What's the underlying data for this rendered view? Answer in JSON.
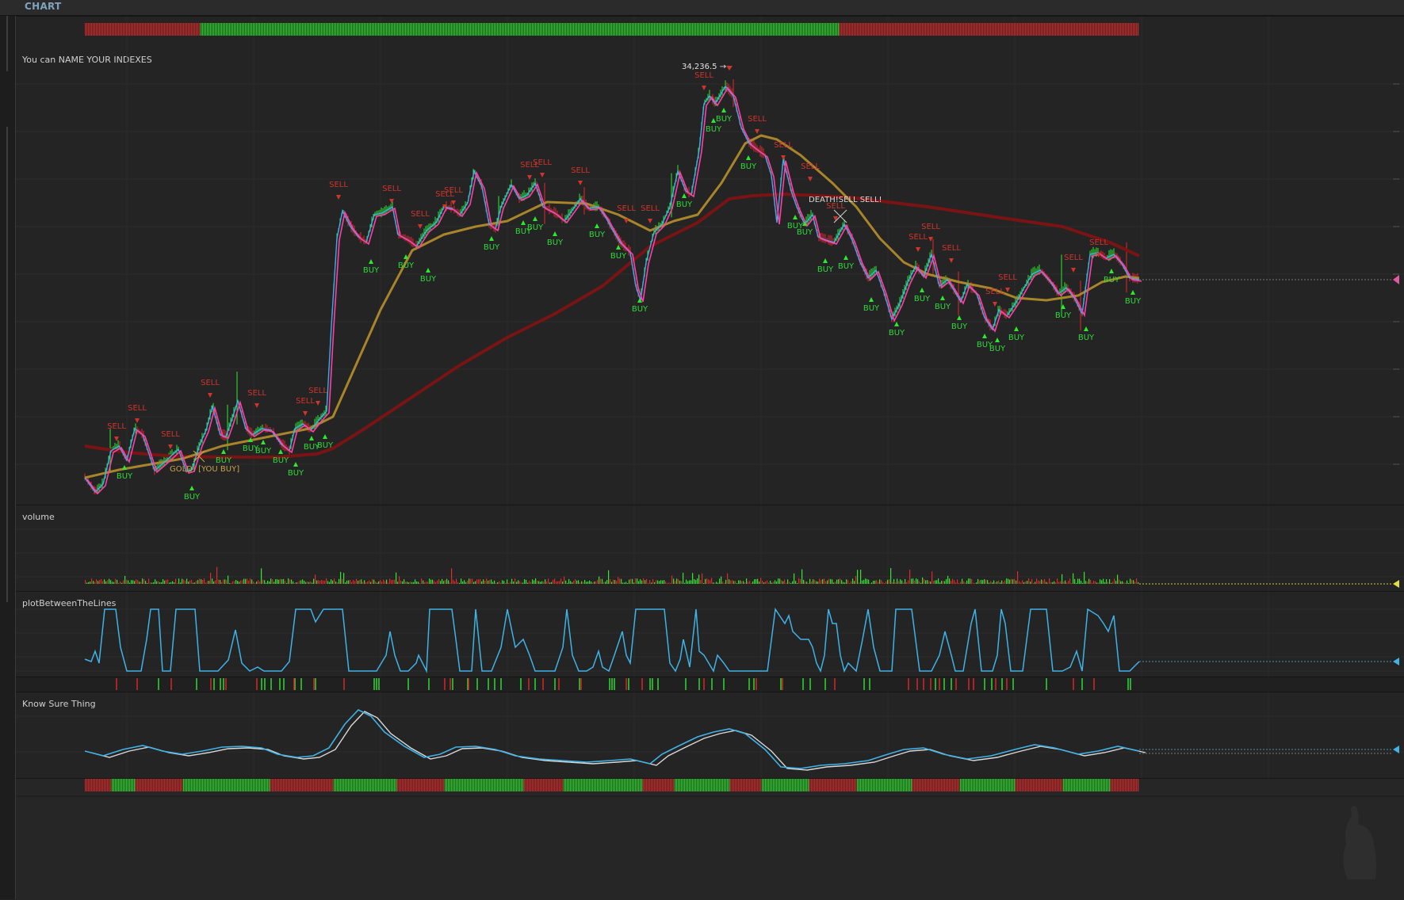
{
  "header": {
    "title": "CHART"
  },
  "panes": {
    "price": {
      "label": "You can NAME YOUR INDEXES",
      "peak_label": "34,236.5 →",
      "gold_cross": "GOLD! [YOU BUY]",
      "death_cross": "DEATH!SELL SELL!",
      "buy": "BUY",
      "sell": "SELL"
    },
    "volume": {
      "label": "volume"
    },
    "between": {
      "label": "plotBetweenTheLines"
    },
    "kst": {
      "label": "Know Sure Thing"
    }
  },
  "colors": {
    "bull": "#2ee82e",
    "bear": "#e02a2a",
    "sell_text": "#d0342c",
    "buy_text": "#2fd93a",
    "fast_ma": "#ff3fa8",
    "fast_ma2": "#3fb8ff",
    "ma50": "#a8852a",
    "ma200": "#7a1414",
    "osc": "#3fb2e6",
    "kst_signal": "#d8d8d8"
  },
  "chart_data": [
    {
      "type": "line",
      "title": "You can NAME YOUR INDEXES",
      "series": [],
      "annotations": [
        "34,236.5",
        "GOLD! [YOU BUY]",
        "DEATH!SELL SELL!",
        "BUY",
        "SELL"
      ]
    },
    {
      "type": "bar",
      "title": "volume",
      "series": []
    },
    {
      "type": "line",
      "title": "plotBetweenTheLines",
      "series": []
    },
    {
      "type": "line",
      "title": "Know Sure Thing",
      "series": []
    }
  ]
}
